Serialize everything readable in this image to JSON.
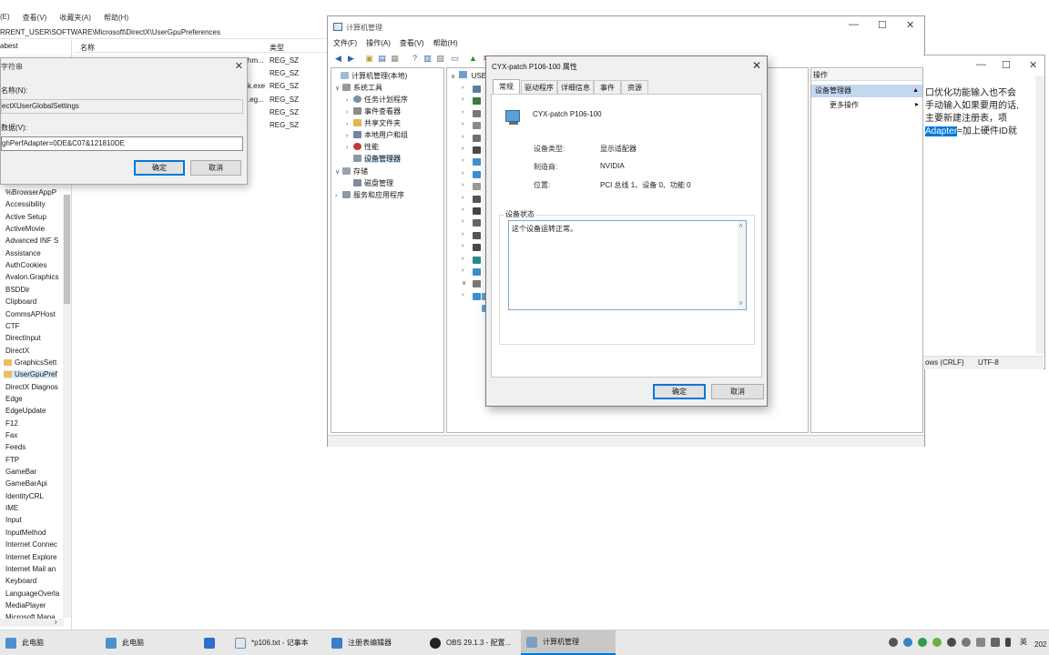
{
  "regedit": {
    "menu": [
      "(E)",
      "查看(V)",
      "收藏夹(A)",
      "帮助(H)"
    ],
    "address": "RRENT_USER\\SOFTWARE\\Microsoft\\DirectX\\UserGpuPreferences",
    "tree_header": "abest",
    "col_name": "名称",
    "col_type": "类型",
    "values": [
      {
        "name": "hm...",
        "type": "REG_SZ"
      },
      {
        "name": "",
        "type": "REG_SZ"
      },
      {
        "name": "k.exe",
        "type": "REG_SZ"
      },
      {
        "name": ".eg...",
        "type": "REG_SZ"
      },
      {
        "name": "",
        "type": "REG_SZ"
      },
      {
        "name": "",
        "type": "REG_SZ"
      }
    ],
    "tree": [
      "%BrowserAppP",
      "Accessibility",
      "Active Setup",
      "ActiveMovie",
      "Advanced INF S",
      "Assistance",
      "AuthCookies",
      "Avalon.Graphics",
      "BSDDir",
      "Clipboard",
      "CommsAPHost",
      "CTF",
      "DirectInput",
      "DirectX",
      "GraphicsSett",
      "UserGpuPref",
      "DirectX Diagnos",
      "Edge",
      "EdgeUpdate",
      "F12",
      "Fax",
      "Feeds",
      "FTP",
      "GameBar",
      "GameBarApi",
      "IdentityCRL",
      "IME",
      "Input",
      "InputMethod",
      "Internet Connec",
      "Internet Explore",
      "Internet Mail an",
      "Keyboard",
      "LanguageOverla",
      "MediaPlayer",
      "Microsoft Mana"
    ]
  },
  "edit_dialog": {
    "title": "字符串",
    "name_label": "名称(N):",
    "name_value": "ectXUserGlobalSettings",
    "data_label": "数据(V):",
    "data_value": "ghPerfAdapter=0DE&C07&121810DE",
    "ok": "确定",
    "cancel": "取消"
  },
  "compmgmt": {
    "title": "计算机管理",
    "menu": [
      "文件(F)",
      "操作(A)",
      "查看(V)",
      "帮助(H)"
    ],
    "tree": {
      "root": "计算机管理(本地)",
      "system_tools": "系统工具",
      "task_scheduler": "任务计划程序",
      "event_viewer": "事件查看器",
      "shared_folders": "共享文件夹",
      "local_users": "本地用户和组",
      "performance": "性能",
      "device_manager": "设备管理器",
      "storage": "存储",
      "disk_management": "磁盘管理",
      "services": "服务和应用程序"
    },
    "middle_root": "USER",
    "actions": {
      "header": "操作",
      "section": "设备管理器",
      "more": "更多操作"
    }
  },
  "notepad": {
    "lines": [
      "口优化功能输入也不会",
      "手动输入如果要用的话,",
      "主要新建注册表，项"
    ],
    "highlight": "Adapter",
    "after_highlight": "=加上硬件ID就",
    "status_eol": "ows (CRLF)",
    "status_enc": "UTF-8"
  },
  "properties": {
    "title": "CYX-patch P106-100 属性",
    "tabs": [
      "常规",
      "驱动程序",
      "详细信息",
      "事件",
      "资源"
    ],
    "device_name": "CYX-patch P106-100",
    "type_label": "设备类型:",
    "type_value": "显示适配器",
    "mfr_label": "制造商:",
    "mfr_value": "NVIDIA",
    "loc_label": "位置:",
    "loc_value": "PCI 总线 1、设备 0、功能 0",
    "status_legend": "设备状态",
    "status_text": "这个设备运转正常。",
    "ok": "确定",
    "cancel": "取消"
  },
  "taskbar": {
    "items": [
      "此电脑",
      "此电脑",
      "",
      "*p106.txt - 记事本",
      "注册表编辑器",
      "OBS 29.1.3 - 配置...",
      "计算机管理"
    ],
    "ime": "英",
    "clock": "202"
  },
  "colors": {
    "accent": "#0078d7",
    "selection": "#cce4f7"
  }
}
